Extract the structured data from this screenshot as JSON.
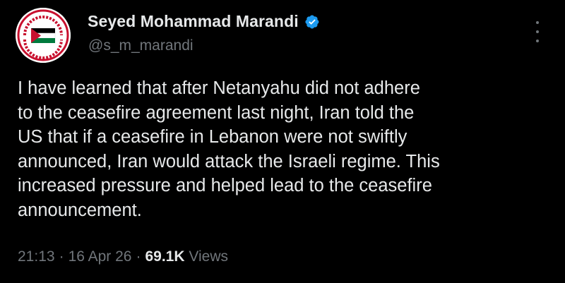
{
  "author": {
    "display_name": "Seyed Mohammad Marandi",
    "handle": "@s_m_marandi",
    "verified_icon": "verified-badge-icon",
    "avatar_colors": {
      "red": "#c8102e",
      "green": "#007a3d",
      "black": "#000000",
      "white": "#ffffff"
    }
  },
  "tweet": {
    "text": "I have learned that after Netanyahu did not adhere\nto the ceasefire agreement last night, Iran told the\nUS that if a ceasefire in Lebanon were not swiftly\nannounced, Iran would attack the Israeli regime. This\nincreased pressure and helped lead to the ceasefire\nannouncement."
  },
  "meta": {
    "time": "21:13",
    "sep1": "·",
    "date": "16 Apr 26",
    "sep2": "·",
    "views_count": "69.1K",
    "views_label": "Views"
  },
  "colors": {
    "background": "#000000",
    "text_primary": "#e7e9ea",
    "text_secondary": "#71767b",
    "verified_blue": "#1d9bf0"
  }
}
